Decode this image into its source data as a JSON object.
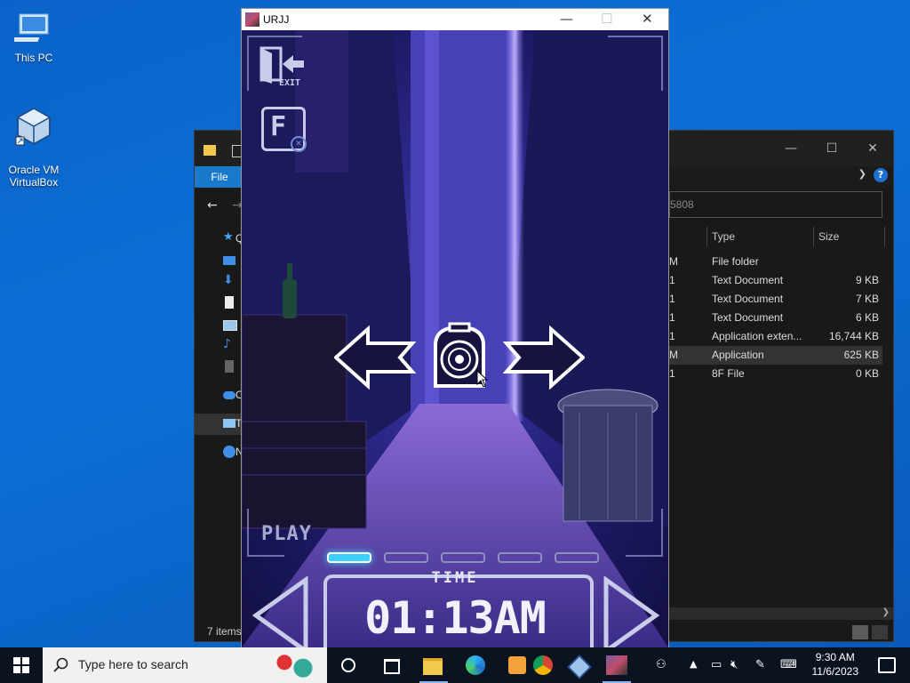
{
  "desktop": {
    "icons": [
      {
        "label": "This PC",
        "icon": "computer-icon"
      },
      {
        "label": "Oracle VM\nVirtualBox",
        "icon": "virtualbox-icon"
      }
    ]
  },
  "explorer": {
    "file_tab": "File",
    "address_fragment": "5808",
    "nav_items": [
      {
        "label": "Q",
        "icon": "quick-access-icon"
      },
      {
        "label": "",
        "icon": "desktop-icon"
      },
      {
        "label": "",
        "icon": "downloads-icon"
      },
      {
        "label": "",
        "icon": "documents-icon"
      },
      {
        "label": "",
        "icon": "pictures-icon"
      },
      {
        "label": "",
        "icon": "music-icon"
      },
      {
        "label": "",
        "icon": "videos-icon"
      },
      {
        "label": "O",
        "icon": "onedrive-icon"
      },
      {
        "label": "T",
        "icon": "this-pc-icon"
      },
      {
        "label": "N",
        "icon": "network-icon"
      }
    ],
    "columns": {
      "type": "Type",
      "size": "Size"
    },
    "rows": [
      {
        "frag": "M",
        "type": "File folder",
        "size": ""
      },
      {
        "frag": "1",
        "type": "Text Document",
        "size": "9 KB"
      },
      {
        "frag": "1",
        "type": "Text Document",
        "size": "7 KB"
      },
      {
        "frag": "1",
        "type": "Text Document",
        "size": "6 KB"
      },
      {
        "frag": "1",
        "type": "Application exten...",
        "size": "16,744 KB"
      },
      {
        "frag": "M",
        "type": "Application",
        "size": "625 KB"
      },
      {
        "frag": "1",
        "type": "8F File",
        "size": "0 KB"
      }
    ],
    "status": "7 items"
  },
  "game": {
    "title": "URJJ",
    "exit_label": "EXIT",
    "f_label": "F",
    "play_label": "PLAY",
    "time_label": "TIME",
    "time_value": "01:13AM",
    "page_count": 5,
    "active_page": 1
  },
  "taskbar": {
    "search_placeholder": "Type here to search",
    "clock_time": "9:30 AM",
    "clock_date": "11/6/2023"
  },
  "colors": {
    "file_tab": "#1979ca",
    "taskbar": "#0b1220",
    "game_accent": "#3bd1ff"
  }
}
